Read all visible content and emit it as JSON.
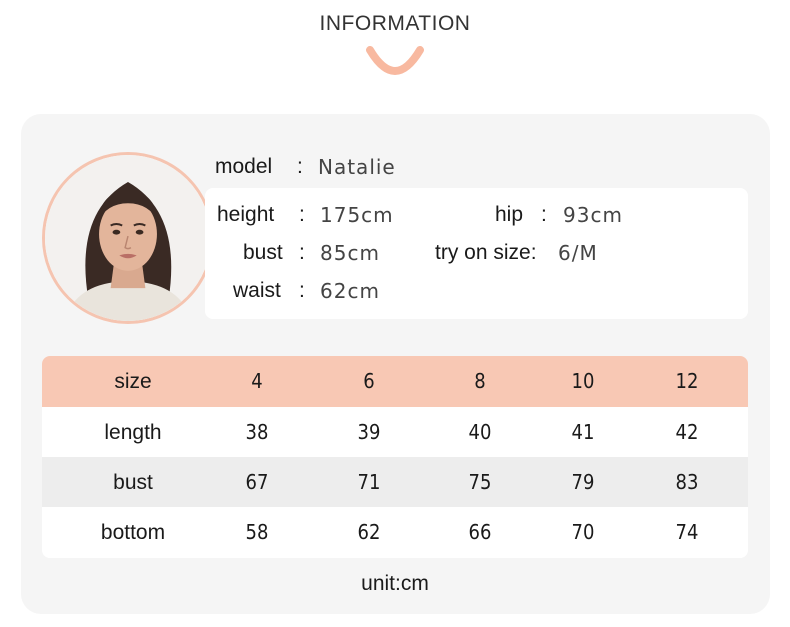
{
  "heading": "INFORMATION",
  "model": {
    "name_label": "model",
    "name": "Natalie",
    "height_label": "height",
    "height": "175cm",
    "hip_label": "hip",
    "hip": "93cm",
    "bust_label": "bust",
    "bust": "85cm",
    "try_on_label": "try on size:",
    "try_on": "6/M",
    "waist_label": "waist",
    "waist": "62cm",
    "colon": ":"
  },
  "size_table": {
    "header": [
      "size",
      "4",
      "6",
      "8",
      "10",
      "12"
    ],
    "rows": [
      [
        "length",
        "38",
        "39",
        "40",
        "41",
        "42"
      ],
      [
        "bust",
        "67",
        "71",
        "75",
        "79",
        "83"
      ],
      [
        "bottom",
        "58",
        "62",
        "66",
        "70",
        "74"
      ]
    ]
  },
  "unit": "unit:cm",
  "colors": {
    "accent": "#f8c8b4",
    "card": "#f5f5f5",
    "stripe": "#ededed"
  }
}
